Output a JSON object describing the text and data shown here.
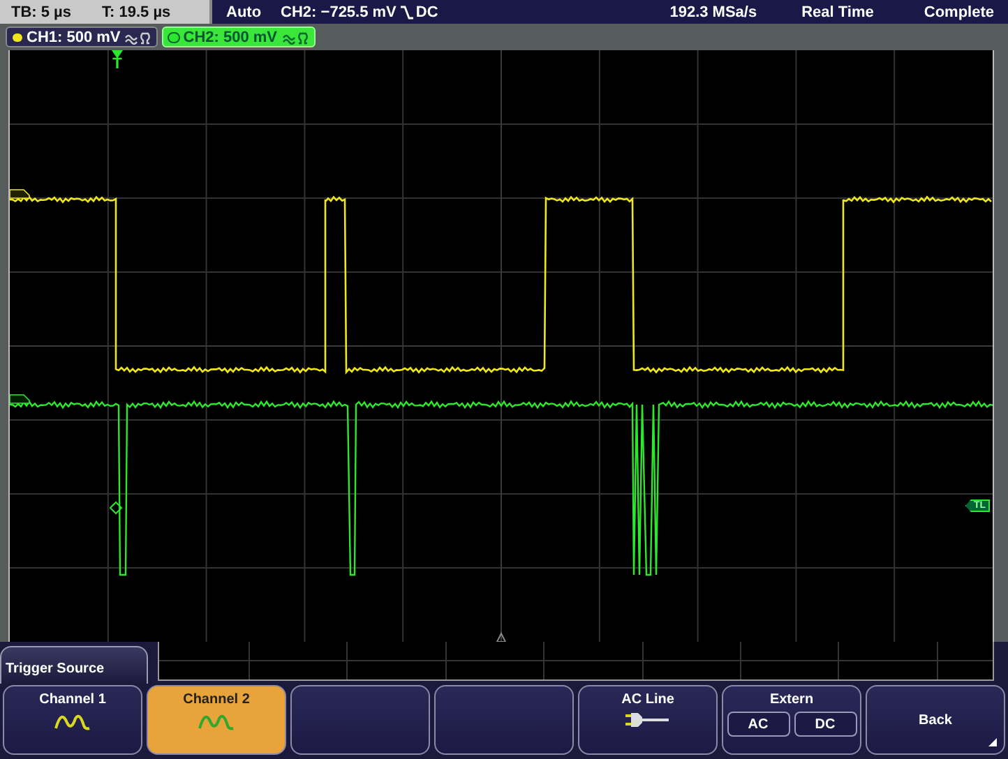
{
  "status_bar": {
    "timebase": "TB: 5 µs",
    "trigger_time": "T: 19.5 µs",
    "mode": "Auto",
    "trigger_level": "CH2: −725.5 mV",
    "coupling": "DC",
    "sample_rate": "192.3 MSa/s",
    "acquisition": "Real Time",
    "state": "Complete"
  },
  "channels": [
    {
      "label": "CH1: 500 mV",
      "color": "#f0e61e",
      "selected": false
    },
    {
      "label": "CH2: 500 mV",
      "color": "#2ee62e",
      "selected": true
    }
  ],
  "screen": {
    "trigger_marker": "T",
    "trigger_level_marker": "TL"
  },
  "menu": {
    "title": "Trigger Source",
    "keys": [
      {
        "kind": "channel",
        "label": "Channel 1",
        "color": "#d8d820",
        "selected": false
      },
      {
        "kind": "channel",
        "label": "Channel 2",
        "color": "#2ea82e",
        "selected": true
      },
      {
        "kind": "empty"
      },
      {
        "kind": "empty"
      },
      {
        "kind": "plug",
        "label": "AC Line"
      },
      {
        "kind": "pair",
        "label": "Extern",
        "options": [
          "AC",
          "DC"
        ]
      },
      {
        "kind": "back",
        "label": "Back"
      }
    ]
  }
}
